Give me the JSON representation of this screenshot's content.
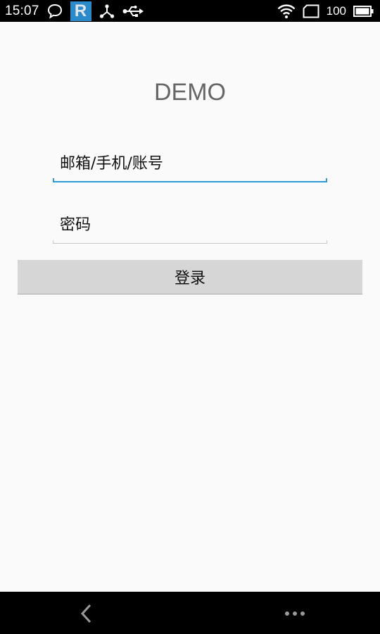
{
  "status_bar": {
    "time": "15:07",
    "battery_level": "100",
    "badge_letter": "R",
    "icons": [
      "chat-bubble-icon",
      "r-app-icon",
      "share-icon",
      "usb-icon",
      "wifi-icon",
      "no-sim-icon",
      "battery-icon"
    ],
    "badge_color": "#2b8ac9"
  },
  "main": {
    "app_title": "DEMO",
    "account_field": {
      "placeholder": "邮箱/手机/账号",
      "value": ""
    },
    "password_field": {
      "placeholder": "密码",
      "value": ""
    },
    "login_label": "登录"
  },
  "nav_bar": {
    "icons": [
      "back-icon",
      "more-icon"
    ]
  },
  "colors": {
    "focus_accent": "#2f9bd6",
    "background": "#fafafa",
    "button_bg": "#d6d6d6"
  }
}
